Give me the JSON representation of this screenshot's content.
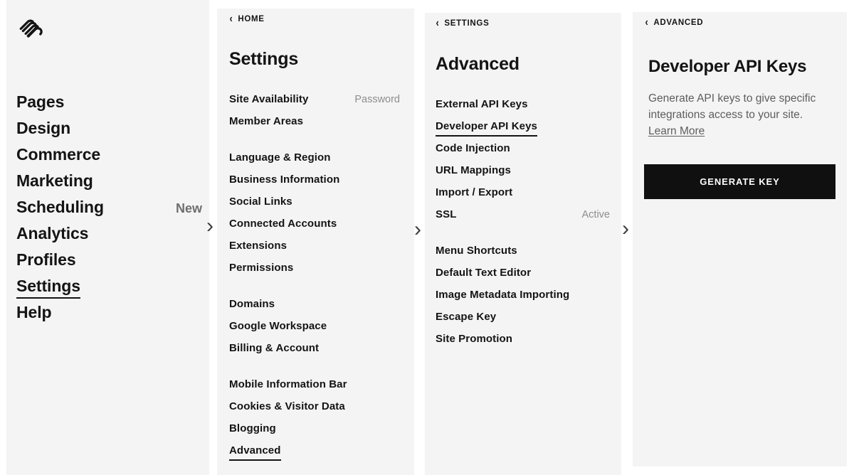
{
  "app": {
    "logo": "squarespace-logo"
  },
  "panels": {
    "home": {
      "items": [
        {
          "label": "Pages",
          "badge": "",
          "active": false
        },
        {
          "label": "Design",
          "badge": "",
          "active": false
        },
        {
          "label": "Commerce",
          "badge": "",
          "active": false
        },
        {
          "label": "Marketing",
          "badge": "",
          "active": false
        },
        {
          "label": "Scheduling",
          "badge": "New",
          "active": false
        },
        {
          "label": "Analytics",
          "badge": "",
          "active": false
        },
        {
          "label": "Profiles",
          "badge": "",
          "active": false
        },
        {
          "label": "Settings",
          "badge": "",
          "active": true
        },
        {
          "label": "Help",
          "badge": "",
          "active": false
        }
      ]
    },
    "settings": {
      "back_label": "HOME",
      "title": "Settings",
      "groups": [
        {
          "items": [
            {
              "label": "Site Availability",
              "meta": "Password",
              "active": false
            },
            {
              "label": "Member Areas",
              "meta": "",
              "active": false
            }
          ]
        },
        {
          "items": [
            {
              "label": "Language & Region",
              "meta": "",
              "active": false
            },
            {
              "label": "Business Information",
              "meta": "",
              "active": false
            },
            {
              "label": "Social Links",
              "meta": "",
              "active": false
            },
            {
              "label": "Connected Accounts",
              "meta": "",
              "active": false
            },
            {
              "label": "Extensions",
              "meta": "",
              "active": false
            },
            {
              "label": "Permissions",
              "meta": "",
              "active": false
            }
          ]
        },
        {
          "items": [
            {
              "label": "Domains",
              "meta": "",
              "active": false
            },
            {
              "label": "Google Workspace",
              "meta": "",
              "active": false
            },
            {
              "label": "Billing & Account",
              "meta": "",
              "active": false
            }
          ]
        },
        {
          "items": [
            {
              "label": "Mobile Information Bar",
              "meta": "",
              "active": false
            },
            {
              "label": "Cookies & Visitor Data",
              "meta": "",
              "active": false
            },
            {
              "label": "Blogging",
              "meta": "",
              "active": false
            },
            {
              "label": "Advanced",
              "meta": "",
              "active": true
            }
          ]
        }
      ]
    },
    "advanced": {
      "back_label": "SETTINGS",
      "title": "Advanced",
      "groups": [
        {
          "items": [
            {
              "label": "External API Keys",
              "meta": "",
              "active": false
            },
            {
              "label": "Developer API Keys",
              "meta": "",
              "active": true
            },
            {
              "label": "Code Injection",
              "meta": "",
              "active": false
            },
            {
              "label": "URL Mappings",
              "meta": "",
              "active": false
            },
            {
              "label": "Import / Export",
              "meta": "",
              "active": false
            },
            {
              "label": "SSL",
              "meta": "Active",
              "active": false
            }
          ]
        },
        {
          "items": [
            {
              "label": "Menu Shortcuts",
              "meta": "",
              "active": false
            },
            {
              "label": "Default Text Editor",
              "meta": "",
              "active": false
            },
            {
              "label": "Image Metadata Importing",
              "meta": "",
              "active": false
            },
            {
              "label": "Escape Key",
              "meta": "",
              "active": false
            },
            {
              "label": "Site Promotion",
              "meta": "",
              "active": false
            }
          ]
        }
      ]
    },
    "api_keys": {
      "back_label": "ADVANCED",
      "title": "Developer API Keys",
      "description": "Generate API keys to give specific integrations access to your site.",
      "learn_more": "Learn More",
      "generate_button": "GENERATE KEY"
    }
  },
  "separators": {
    "chevron": "›",
    "back_chevron": "‹"
  },
  "colors": {
    "panel_background": "#f4f4f4",
    "page_background": "#ffffff",
    "text_primary": "#141414",
    "text_muted": "#8d8d8d",
    "button_background": "#101010",
    "button_text": "#ffffff"
  }
}
